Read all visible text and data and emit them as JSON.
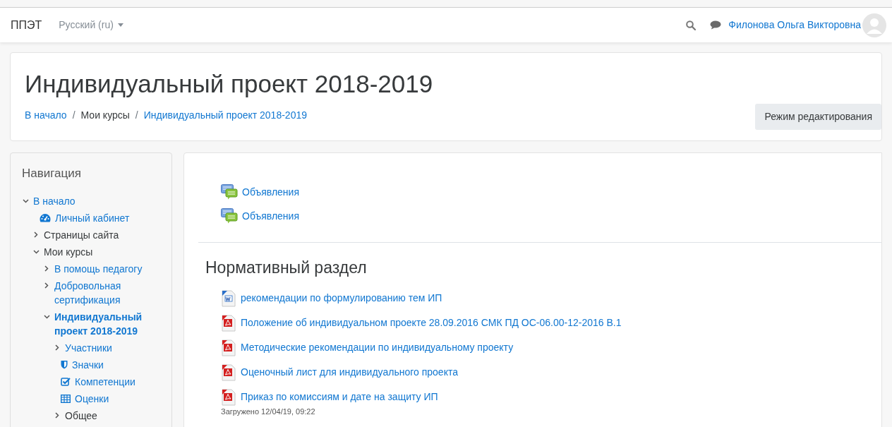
{
  "navbar": {
    "brand": "ППЭТ",
    "language": "Русский (ru)",
    "user_name": "Филонова Ольга Викторовна"
  },
  "header": {
    "title": "Индивидуальный проект 2018-2019",
    "breadcrumbs": [
      {
        "label": "В начало",
        "link": true
      },
      {
        "label": "Мои курсы",
        "link": false
      },
      {
        "label": "Индивидуальный проект 2018-2019",
        "link": true
      }
    ],
    "separator": "/",
    "edit_button": "Режим редактирования"
  },
  "navigation": {
    "title": "Навигация",
    "items": [
      {
        "kind": "branch",
        "label": "В начало",
        "link": true,
        "expanded": true,
        "selected": false,
        "children": [
          {
            "kind": "dashboard",
            "label": "Личный кабинет",
            "link": true,
            "selected": false
          },
          {
            "kind": "branch",
            "label": "Страницы сайта",
            "link": false,
            "expanded": false,
            "selected": false
          },
          {
            "kind": "branch",
            "label": "Мои курсы",
            "link": false,
            "expanded": true,
            "selected": false,
            "children": [
              {
                "kind": "branch",
                "label": "В помощь педагогу",
                "link": true,
                "expanded": false,
                "selected": false
              },
              {
                "kind": "branch",
                "label": "Добровольная сертификация",
                "link": true,
                "expanded": false,
                "selected": false
              },
              {
                "kind": "branch",
                "label": "Индивидуальный проект 2018-2019",
                "link": true,
                "expanded": true,
                "selected": true,
                "children": [
                  {
                    "kind": "branch",
                    "label": "Участники",
                    "link": true,
                    "expanded": false,
                    "selected": false
                  },
                  {
                    "kind": "badge",
                    "label": "Значки",
                    "link": true,
                    "selected": false
                  },
                  {
                    "kind": "competency",
                    "label": "Компетенции",
                    "link": true,
                    "selected": false
                  },
                  {
                    "kind": "grades",
                    "label": "Оценки",
                    "link": true,
                    "selected": false
                  },
                  {
                    "kind": "branch",
                    "label": "Общее",
                    "link": false,
                    "expanded": false,
                    "selected": false
                  }
                ]
              }
            ]
          }
        ]
      }
    ]
  },
  "course": {
    "top_activities": [
      {
        "kind": "forum",
        "label": "Объявления"
      },
      {
        "kind": "forum",
        "label": "Объявления"
      }
    ],
    "sections": [
      {
        "title": "Нормативный раздел",
        "activities": [
          {
            "kind": "word",
            "label": "рекомендации по формулированию тем ИП"
          },
          {
            "kind": "pdf",
            "label": "Положение об индивидуальном проекте 28.09.2016 СМК ПД ОС-06.00-12-2016 В.1"
          },
          {
            "kind": "pdf",
            "label": "Методические рекомендации по индивидуальному проекту"
          },
          {
            "kind": "pdf",
            "label": "Оценочный лист для индивидуального проекта"
          },
          {
            "kind": "pdf",
            "label": "Приказ по комиссиям и дате на защиту ИП",
            "note": "Загружено 12/04/19, 09:22"
          }
        ]
      }
    ]
  }
}
